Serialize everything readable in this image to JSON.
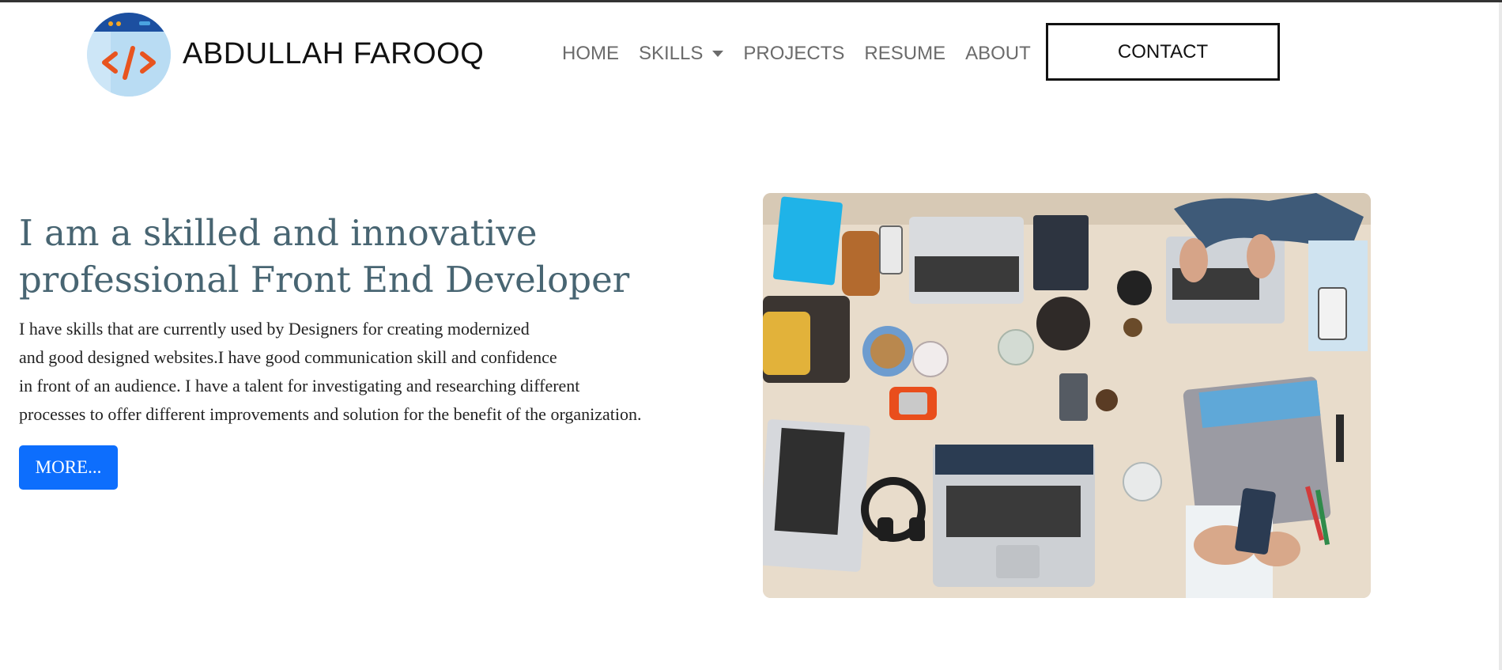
{
  "navbar": {
    "brand": "ABDULLAH FAROOQ",
    "logo_icon": "code-brackets-icon",
    "links": [
      {
        "label": "HOME"
      },
      {
        "label": "SKILLS",
        "has_dropdown": true
      },
      {
        "label": "PROJECTS"
      },
      {
        "label": "RESUME"
      },
      {
        "label": "ABOUT"
      }
    ],
    "contact_label": "CONTACT"
  },
  "hero": {
    "headline_lines": [
      "I am a skilled and innovative",
      "professional Front End Developer"
    ],
    "description_lines": [
      "I have skills that are currently used by Designers for creating modernized",
      "and good designed websites.I have good communication skill and confidence",
      "in front of an audience. I have a talent for investigating and researching different",
      "processes to offer different improvements and solution for the benefit of the organization."
    ],
    "more_label": "MORE...",
    "image_alt": "workspace-desk-photo"
  },
  "colors": {
    "primary_button": "#0d6efd",
    "headline": "#486572",
    "nav_link": "#6b6b6b",
    "brand": "#111111"
  }
}
